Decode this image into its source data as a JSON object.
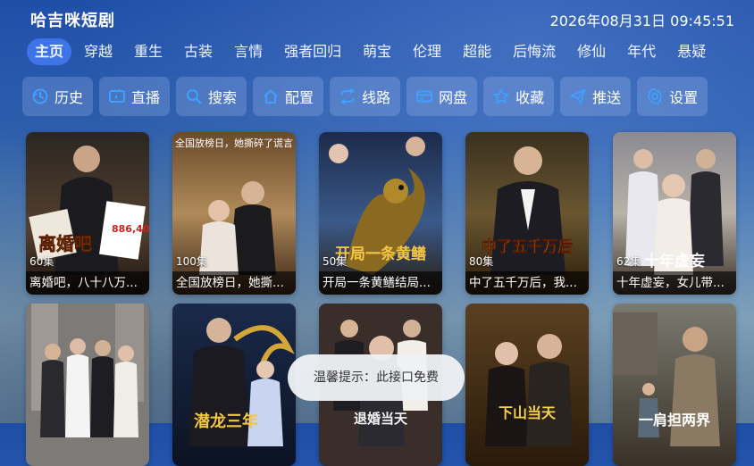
{
  "app": {
    "title": "哈吉咪短剧",
    "datetime": "2026年08月31日 09:45:51"
  },
  "tabs": [
    {
      "label": "主页",
      "active": true
    },
    {
      "label": "穿越"
    },
    {
      "label": "重生"
    },
    {
      "label": "古装"
    },
    {
      "label": "言情"
    },
    {
      "label": "强者回归"
    },
    {
      "label": "萌宝"
    },
    {
      "label": "伦理"
    },
    {
      "label": "超能"
    },
    {
      "label": "后悔流"
    },
    {
      "label": "修仙"
    },
    {
      "label": "年代"
    },
    {
      "label": "悬疑"
    }
  ],
  "toolbar": [
    {
      "label": "历史",
      "icon": "clock-icon"
    },
    {
      "label": "直播",
      "icon": "tv-icon"
    },
    {
      "label": "搜索",
      "icon": "search-icon"
    },
    {
      "label": "配置",
      "icon": "home-icon"
    },
    {
      "label": "线路",
      "icon": "swap-icon"
    },
    {
      "label": "网盘",
      "icon": "card-icon"
    },
    {
      "label": "收藏",
      "icon": "star-icon"
    },
    {
      "label": "推送",
      "icon": "send-icon"
    },
    {
      "label": "设置",
      "icon": "gear-icon"
    }
  ],
  "colors": {
    "accent": "#3f73e8",
    "toolbar_bg": "#bed2ff",
    "toast_bg": "#eef0f4"
  },
  "cards_row1": [
    {
      "episodes": "60集",
      "title": "离婚吧，八十八万...",
      "poster_text": "离婚吧"
    },
    {
      "episodes": "100集",
      "title": "全国放榜日，她撕...",
      "poster_text": "全国放榜日，她撕碎了谎言"
    },
    {
      "episodes": "50集",
      "title": "开局一条黄鳝结局...",
      "poster_text": "开局一条黄鳝"
    },
    {
      "episodes": "80集",
      "title": "中了五千万后，我...",
      "poster_text": "中了五千万后"
    },
    {
      "episodes": "62集",
      "title": "十年虚妄，女儿带...",
      "poster_text": "十年虚妄"
    }
  ],
  "cards_row2": [
    {
      "poster_text": ""
    },
    {
      "poster_text": "潜龙三年"
    },
    {
      "poster_text": "退婚当天"
    },
    {
      "poster_text": "下山当天"
    },
    {
      "poster_text": "一肩担两界"
    }
  ],
  "toast": {
    "message": "温馨提示：此接口免费"
  }
}
